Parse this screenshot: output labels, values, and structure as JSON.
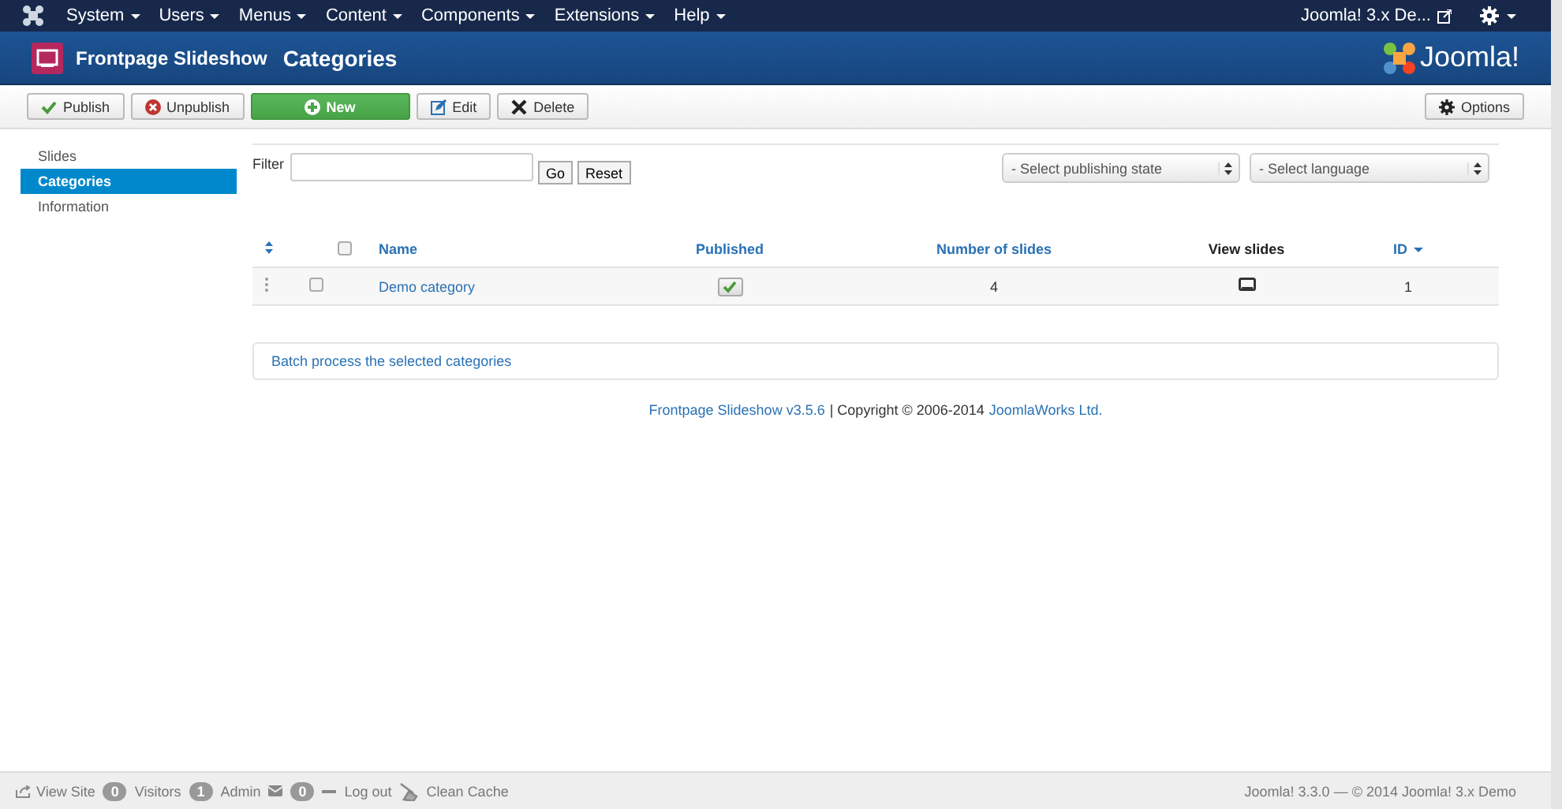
{
  "menubar": {
    "items": [
      {
        "label": "System"
      },
      {
        "label": "Users"
      },
      {
        "label": "Menus"
      },
      {
        "label": "Content"
      },
      {
        "label": "Components"
      },
      {
        "label": "Extensions"
      },
      {
        "label": "Help"
      }
    ],
    "site_link": "Joomla! 3.x De..."
  },
  "header": {
    "component": "Frontpage Slideshow",
    "title": "Categories",
    "logo_text": "Joomla!"
  },
  "toolbar": {
    "buttons": [
      {
        "label": "Publish",
        "kind": "publish"
      },
      {
        "label": "Unpublish",
        "kind": "unpublish"
      },
      {
        "label": "New",
        "kind": "new"
      },
      {
        "label": "Edit",
        "kind": "edit"
      },
      {
        "label": "Delete",
        "kind": "delete"
      }
    ],
    "options": "Options"
  },
  "sidebar": {
    "items": [
      {
        "label": "Slides",
        "selected": false
      },
      {
        "label": "Categories",
        "selected": true
      },
      {
        "label": "Information",
        "selected": false
      }
    ]
  },
  "filter": {
    "label": "Filter",
    "go": "Go",
    "reset": "Reset",
    "selects": [
      {
        "placeholder": "- Select publishing state"
      },
      {
        "placeholder": "- Select language"
      }
    ]
  },
  "table": {
    "columns": [
      {
        "kind": "ordering"
      },
      {
        "kind": "checkbox",
        "checked": false
      },
      {
        "kind": "text",
        "label": "Name",
        "sortable": true,
        "sorted": false
      },
      {
        "kind": "text",
        "label": "Published",
        "sortable": true,
        "sorted": false
      },
      {
        "kind": "text",
        "label": "Number of slides",
        "sortable": true,
        "sorted": false
      },
      {
        "kind": "text",
        "label": "View slides",
        "sortable": false,
        "sorted": false
      },
      {
        "kind": "text",
        "label": "ID",
        "sortable": true,
        "sorted": true
      }
    ],
    "rows": [
      {
        "checked": false,
        "name": "Demo category",
        "published": true,
        "slides": "4",
        "id": "1"
      }
    ]
  },
  "batch": "Batch process the selected categories",
  "footer": [
    {
      "kind": "link",
      "text": "Frontpage Slideshow v3.5.6"
    },
    {
      "kind": "text",
      "text": "| Copyright © 2006-2014"
    },
    {
      "kind": "link",
      "text": "JoomlaWorks Ltd."
    }
  ],
  "status_bar": {
    "view_site": "View Site",
    "visitors": {
      "count": "0",
      "label": "Visitors"
    },
    "admins": {
      "count": "1",
      "label": "Admin"
    },
    "messages": {
      "count": "0"
    },
    "logout": "Log out",
    "clean_cache": "Clean Cache",
    "version": "Joomla! 3.3.0  —  © 2014 Joomla! 3.x Demo"
  }
}
